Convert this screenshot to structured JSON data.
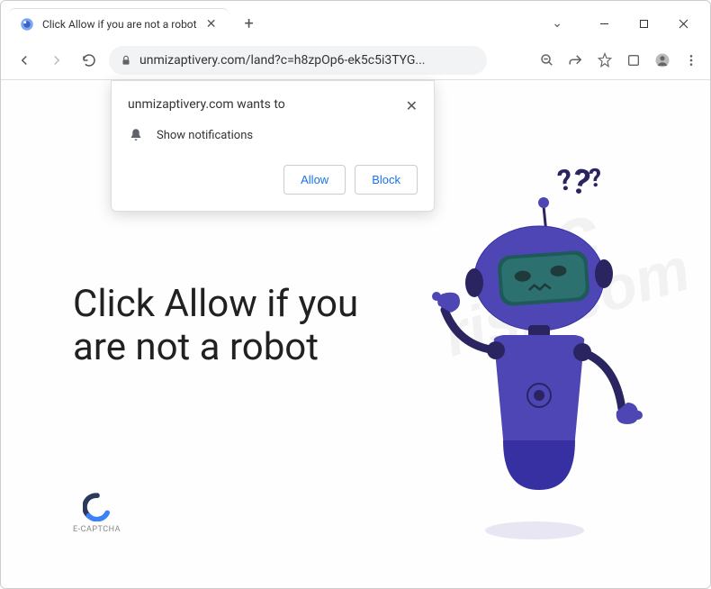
{
  "window": {
    "tab": {
      "title": "Click Allow if you are not a robot"
    }
  },
  "toolbar": {
    "url": "unmizaptivery.com/land?c=h8zpOp6-ek5c5i3TYG..."
  },
  "notification": {
    "site": "unmizaptivery.com wants to",
    "permission": "Show notifications",
    "allow": "Allow",
    "block": "Block"
  },
  "page": {
    "headline": "Click Allow if you are not a robot",
    "captcha_label": "E-CAPTCHA"
  },
  "watermark": {
    "line1": "pc",
    "line2": "risk.com"
  }
}
